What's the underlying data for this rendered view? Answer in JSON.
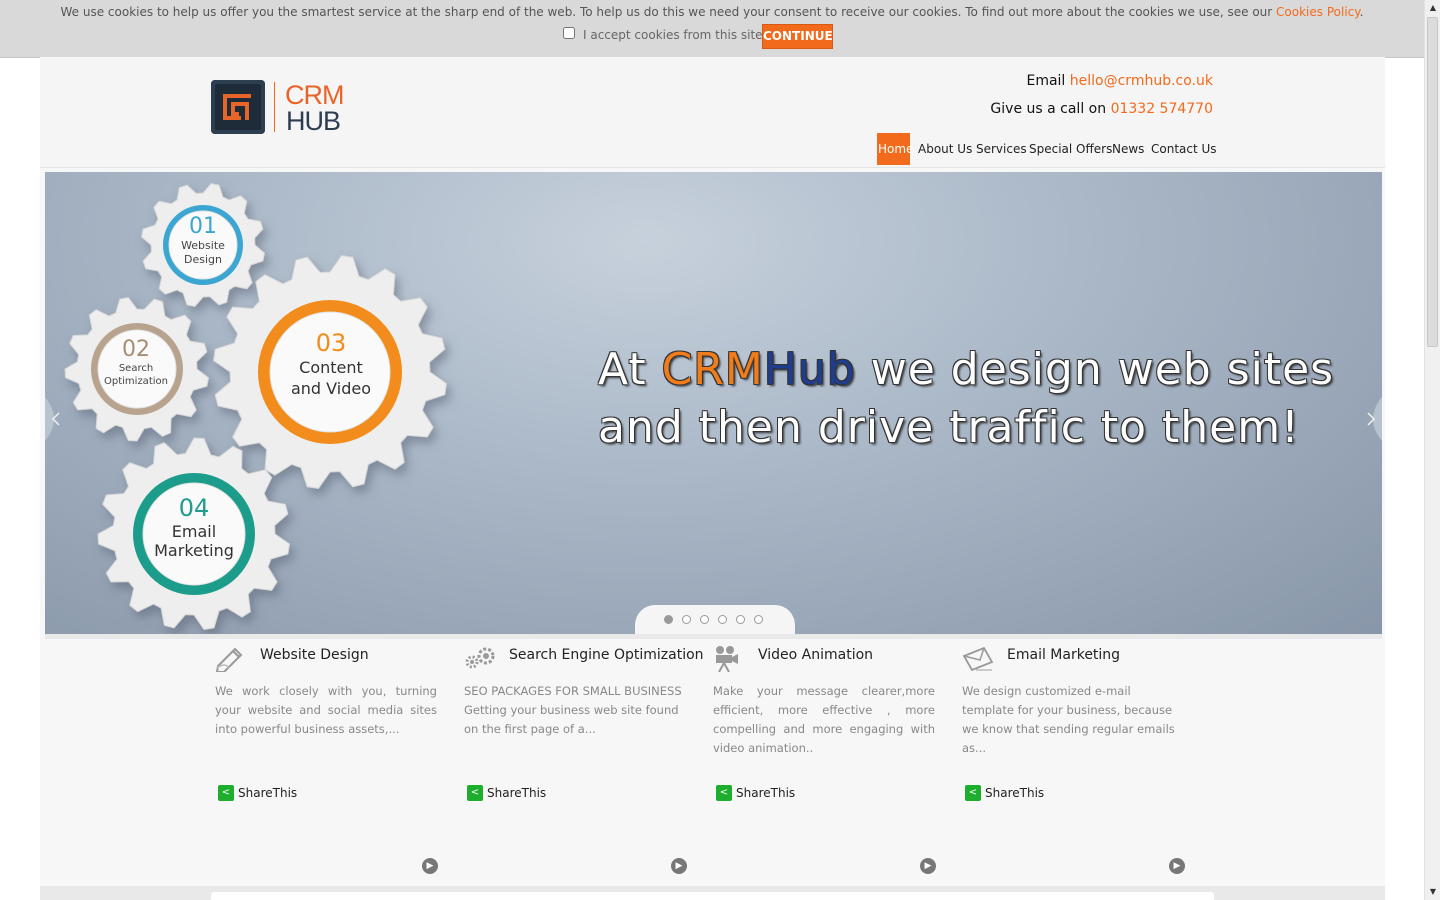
{
  "cookie": {
    "message": "We use cookies to help us offer you the smartest service at the sharp end of the web. To help us do this we need your consent to receive our cookies. To find out more about the cookies we use, see our ",
    "policy_link": "Cookies Policy",
    "period": ".",
    "accept_label": "I accept cookies from this site.",
    "continue_label": "CONTINUE"
  },
  "header": {
    "logo_top": "CRM",
    "logo_bottom": "HUB",
    "email_label": "Email ",
    "email_value": "hello@crmhub.co.uk",
    "call_label": "Give us a call on ",
    "call_value": "01332 574770"
  },
  "nav": {
    "items": [
      {
        "label": "Home",
        "active": true
      },
      {
        "label": "About Us"
      },
      {
        "label": "Services"
      },
      {
        "label": "Special Offers"
      },
      {
        "label": "News"
      },
      {
        "label": "Contact Us"
      }
    ]
  },
  "slider": {
    "headline_line1_pre": "At ",
    "headline_brand_a": "CRM",
    "headline_brand_b": "Hub",
    "headline_line1_post": " we design web sites",
    "headline_line2": "and then drive traffic to them!",
    "gears": [
      {
        "number": "01",
        "label": "Website\nDesign"
      },
      {
        "number": "02",
        "label": "Search\nOptimization"
      },
      {
        "number": "03",
        "label": "Content\nand Video"
      },
      {
        "number": "04",
        "label": "Email\nMarketing"
      }
    ],
    "slide_count": 6,
    "active_slide": 1
  },
  "services": [
    {
      "title": "Website Design",
      "text": "We work closely with you, turning your website and social media sites into powerful business assets,...",
      "share": "ShareThis"
    },
    {
      "title": "Search Engine Optimization",
      "text": "SEO PACKAGES FOR SMALL BUSINESS Getting your business web site found on the first page of a...",
      "share": "ShareThis"
    },
    {
      "title": "Video Animation",
      "text": "Make your message clearer,more efficient, more effective , more compelling and more engaging with video animation..",
      "share": "ShareThis"
    },
    {
      "title": "Email Marketing",
      "text": "We design customized e-mail template for your business, because we know that sending regular emails as...",
      "share": "ShareThis"
    }
  ],
  "colors": {
    "accent": "#f26a1b",
    "brand_blue": "#203c8c",
    "gear_blue": "#3aa6d1",
    "gear_tan": "#b8a48e",
    "gear_orange": "#f28c1a",
    "gear_teal": "#1f9c8a"
  }
}
